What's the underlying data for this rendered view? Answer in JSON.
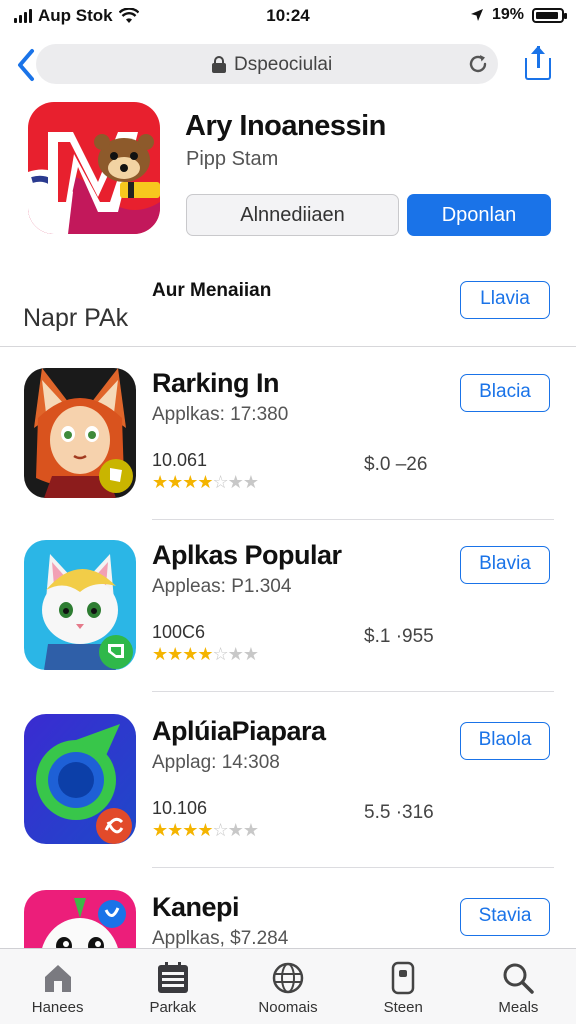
{
  "status": {
    "carrier": "Aup Stok",
    "time": "10:24",
    "battery": "19%"
  },
  "urlbar": {
    "url": "Dspeociulai"
  },
  "featured": {
    "title": "Ary Inoanessin",
    "subtitle": "Pipp Stam",
    "secondary_button": "Alnnediiaen",
    "primary_button": "Dponlan"
  },
  "section": {
    "tag": "Aur Menaiian",
    "title": "Napr PAk",
    "button": "Llavia"
  },
  "apps": [
    {
      "name": "Rarking In",
      "meta": "Applkas: 17:380",
      "count": "10.061",
      "rating": 3.5,
      "price": "$.0 –26",
      "button": "Blacia",
      "icon": "fox-character-icon"
    },
    {
      "name": "Aplkas Popular",
      "meta": "Appleas: P1.304",
      "count": "100C6",
      "rating": 3.5,
      "price": "$.1 ·955",
      "button": "Blavia",
      "icon": "cat-character-icon"
    },
    {
      "name": "AplúiaPiapara",
      "meta": "Applag: 14:308",
      "count": "10.106",
      "rating": 3.5,
      "price": "5.5 ·316",
      "button": "Blaola",
      "icon": "green-ring-icon"
    },
    {
      "name": "Kanepi",
      "meta": "Applkas, $7.284",
      "button": "Stavia",
      "icon": "cartoon-face-icon"
    }
  ],
  "tabs": [
    {
      "label": "Hanees",
      "icon": "home-icon"
    },
    {
      "label": "Parkak",
      "icon": "calendar-icon"
    },
    {
      "label": "Noomais",
      "icon": "globe-icon"
    },
    {
      "label": "Steen",
      "icon": "phone-icon"
    },
    {
      "label": "Meals",
      "icon": "search-icon"
    }
  ],
  "colors": {
    "accent": "#1a73e8",
    "star": "#f4b400"
  }
}
